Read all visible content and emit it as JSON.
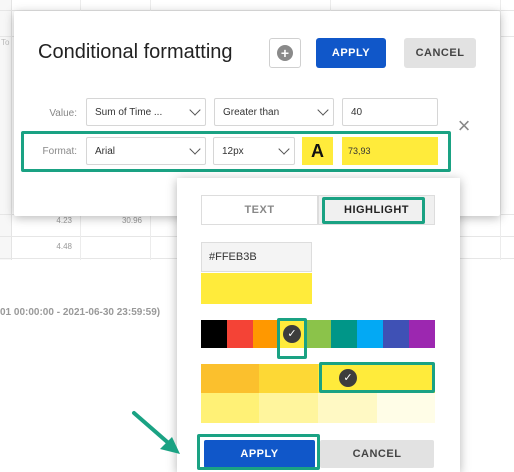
{
  "background": {
    "to_label": "To",
    "cells": [
      "4.23",
      "30.96",
      "4.48"
    ],
    "date_range": "01 00:00:00 - 2021-06-30 23:59:59)"
  },
  "dialog": {
    "title": "Conditional formatting",
    "add_icon": "plus-circle-icon",
    "apply_label": "APPLY",
    "cancel_label": "CANCEL",
    "close_icon": "close-icon",
    "value_row": {
      "label": "Value:",
      "field": "Sum of Time ...",
      "condition": "Greater than",
      "threshold": "40"
    },
    "format_row": {
      "label": "Format:",
      "font": "Arial",
      "size": "12px",
      "font_color_glyph": "A",
      "sample_text": "73,93"
    }
  },
  "picker": {
    "tabs": [
      "TEXT",
      "HIGHLIGHT"
    ],
    "active_tab": "HIGHLIGHT",
    "hex_value": "#FFEB3B",
    "selected_color": "#ffeb3b",
    "main_colors": [
      "#000000",
      "#f44336",
      "#ff9800",
      "#ffeb3b",
      "#8bc34a",
      "#009688",
      "#03a9f4",
      "#3f51b5",
      "#9c27b0"
    ],
    "shade_row_1": [
      "#fbc02d",
      "#fdd835",
      "#ffeb3b"
    ],
    "shade_row_2": [
      "#fff176",
      "#fff59d",
      "#fff9c4",
      "#fffde7"
    ],
    "apply_label": "APPLY",
    "cancel_label": "CANCEL"
  },
  "colors": {
    "accent_blue": "#1057c9",
    "highlight_green": "#1aa283"
  }
}
